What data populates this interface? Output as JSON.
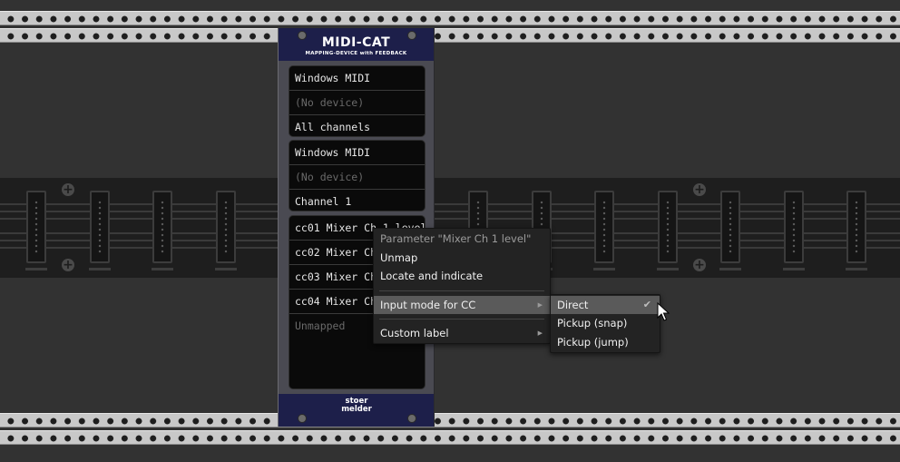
{
  "module": {
    "title": "MIDI-CAT",
    "subtitle": "MAPPING-DEVICE with FEEDBACK",
    "brand_line1": "stoer",
    "brand_line2": "melder",
    "input_box": {
      "driver": "Windows MIDI",
      "device": "(No device)",
      "channel": "All channels"
    },
    "output_box": {
      "driver": "Windows MIDI",
      "device": "(No device)",
      "channel": "Channel 1"
    },
    "mappings": [
      {
        "label": "cc01 Mixer Ch 1 level"
      },
      {
        "label": "cc02 Mixer Ch"
      },
      {
        "label": "cc03 Mixer Ch"
      },
      {
        "label": "cc04 Mixer Ch"
      },
      {
        "label": "Unmapped"
      }
    ]
  },
  "context_menu": {
    "header": "Parameter \"Mixer Ch 1 level\"",
    "items": [
      {
        "label": "Unmap"
      },
      {
        "label": "Locate and indicate"
      },
      {
        "label": "Input mode for CC",
        "submenu": true
      },
      {
        "label": "Custom label",
        "submenu": true
      }
    ],
    "arrow_glyph": "▶"
  },
  "submenu": {
    "items": [
      {
        "label": "Direct",
        "checked": true
      },
      {
        "label": "Pickup (snap)"
      },
      {
        "label": "Pickup (jump)"
      }
    ],
    "check_glyph": "✔"
  },
  "icons": {
    "add": "plus-icon",
    "cursor": "arrow-cursor-icon"
  },
  "colors": {
    "module_panel": "#1d1f4a",
    "menu_bg": "#232323",
    "menu_highlight": "#5a5a5a",
    "rack_rail": "#c8c8c8"
  }
}
